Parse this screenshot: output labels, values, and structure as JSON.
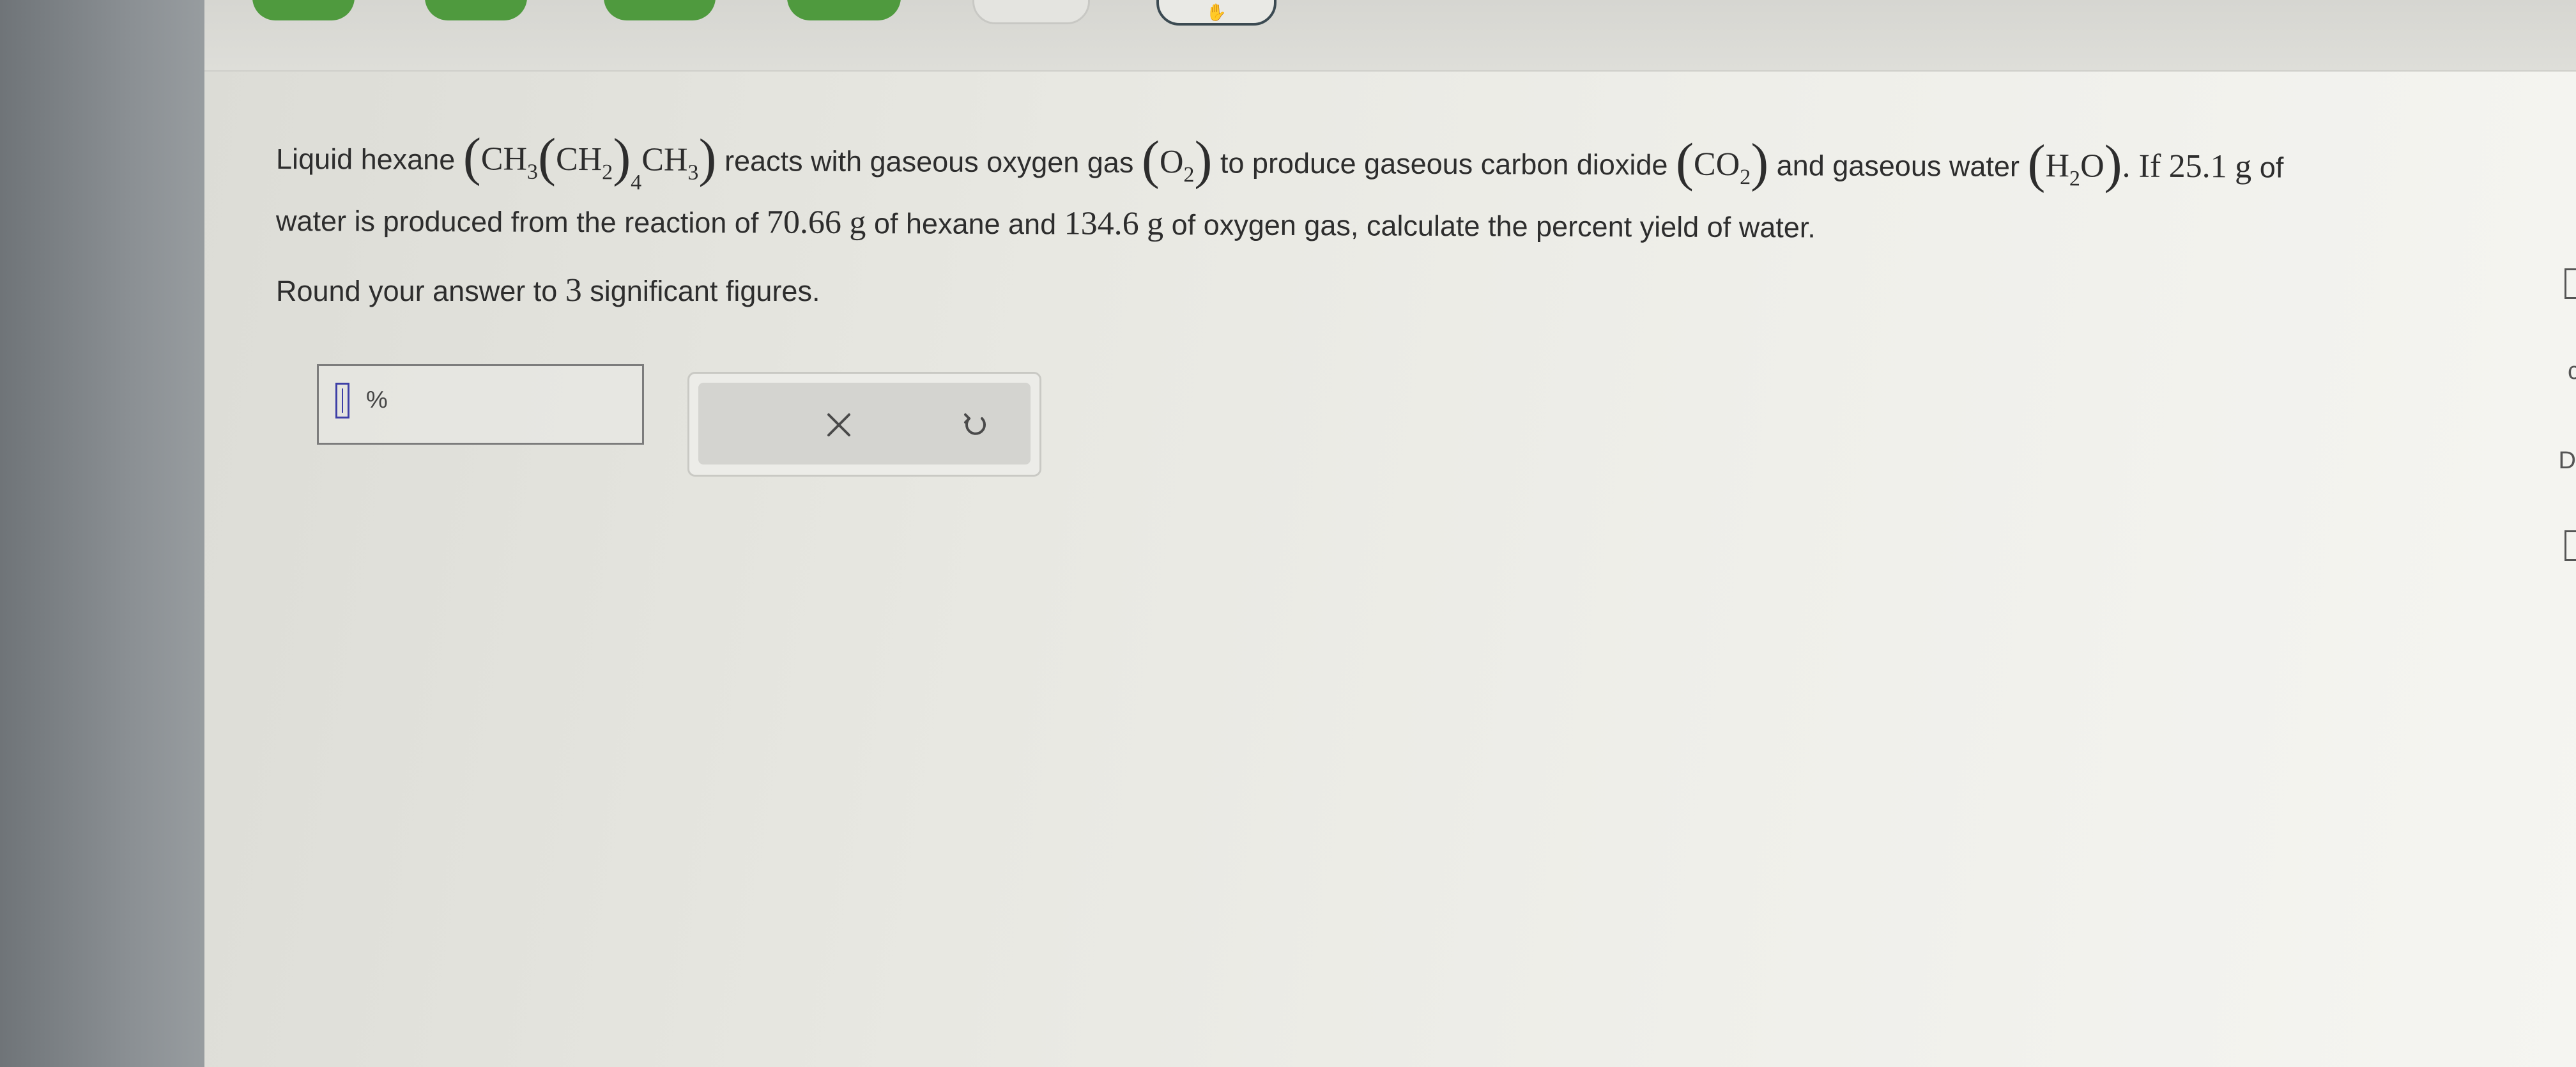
{
  "question": {
    "p1": "Liquid hexane",
    "hexane_formula": [
      "CH",
      "3",
      "CH",
      "2",
      "4",
      "CH",
      "3"
    ],
    "p2": "reacts with gaseous oxygen gas",
    "oxygen_formula": [
      "O",
      "2"
    ],
    "p3": "to produce gaseous carbon dioxide",
    "co2_formula": [
      "CO",
      "2"
    ],
    "p4": "and gaseous water",
    "water_formula": [
      "H",
      "2",
      "O"
    ],
    "p5": ". If",
    "water_mass": "25.1",
    "unit_g": "g",
    "p6": "of",
    "p7": "water is produced from the reaction of",
    "hexane_mass": "70.66",
    "p8": "of hexane and",
    "oxygen_mass": "134.6",
    "p9": "of oxygen gas, calculate the percent yield of water."
  },
  "instructions": {
    "prefix": "Round your answer to",
    "sig_figs": "3",
    "suffix": "significant figures."
  },
  "answer": {
    "value": "",
    "unit": "%"
  },
  "buttons": {
    "clear_icon": "close-icon",
    "undo_icon": "undo-icon"
  },
  "top_nav": {
    "pills": [
      "green",
      "green",
      "green",
      "green",
      "grey",
      "outline"
    ]
  },
  "colors": {
    "nav_green": "#4f9a3e",
    "cursor_blue": "#3d3fa6",
    "text": "#2d2d2d"
  }
}
